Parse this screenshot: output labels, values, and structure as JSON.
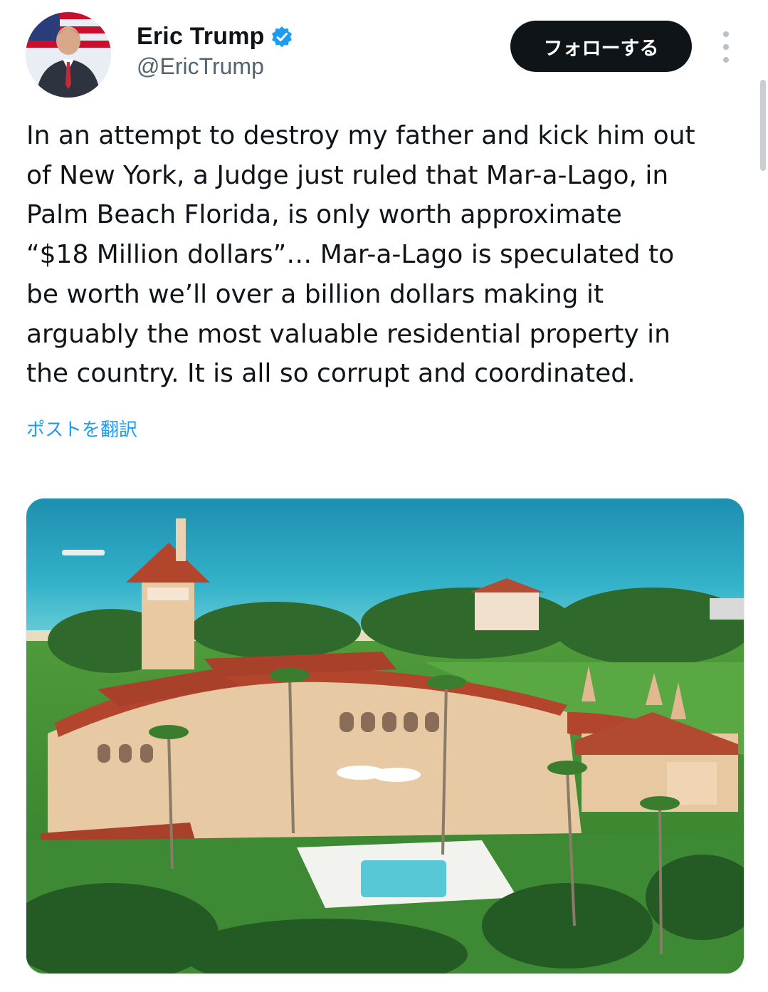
{
  "author": {
    "display_name": "Eric Trump",
    "handle": "@EricTrump",
    "verified": true,
    "avatar_icon": "profile-avatar"
  },
  "actions": {
    "follow_label": "フォローする",
    "more_icon": "more-vertical-icon"
  },
  "tweet": {
    "text": "In an attempt to destroy my father and kick him out\nof New York, a Judge just ruled that Mar-a-Lago, in\nPalm Beach Florida, is only worth approximate\n“$18 Million dollars”… Mar-a-Lago is speculated to\nbe worth we’ll over a billion dollars making it\narguably the most valuable residential property in\nthe country. It is all so corrupt and coordinated.",
    "translate_label": "ポストを翻訳"
  },
  "colors": {
    "accent": "#1d9bf0",
    "follow_bg": "#0f1419",
    "text_primary": "#0f1419",
    "text_secondary": "#536471"
  }
}
